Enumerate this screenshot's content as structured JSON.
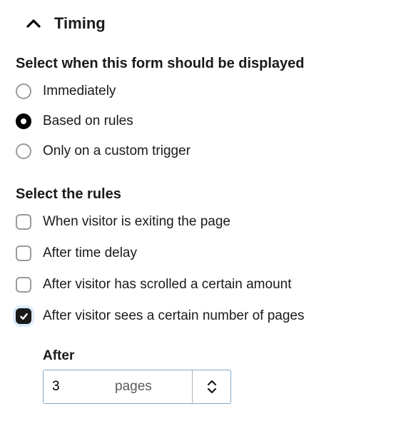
{
  "section": {
    "title": "Timing"
  },
  "display_when": {
    "label": "Select when this form should be displayed",
    "options": {
      "immediately": "Immediately",
      "based_on_rules": "Based on rules",
      "custom_trigger": "Only on a custom trigger"
    },
    "selected": "based_on_rules"
  },
  "rules": {
    "label": "Select the rules",
    "options": {
      "exit_intent": {
        "label": "When visitor is exiting the page",
        "checked": false
      },
      "time_delay": {
        "label": "After time delay",
        "checked": false
      },
      "scroll_amount": {
        "label": "After visitor has scrolled a certain amount",
        "checked": false
      },
      "page_views": {
        "label": "After visitor sees a certain number of pages",
        "checked": true
      }
    }
  },
  "page_views_config": {
    "label": "After",
    "value": "3",
    "unit": "pages"
  }
}
